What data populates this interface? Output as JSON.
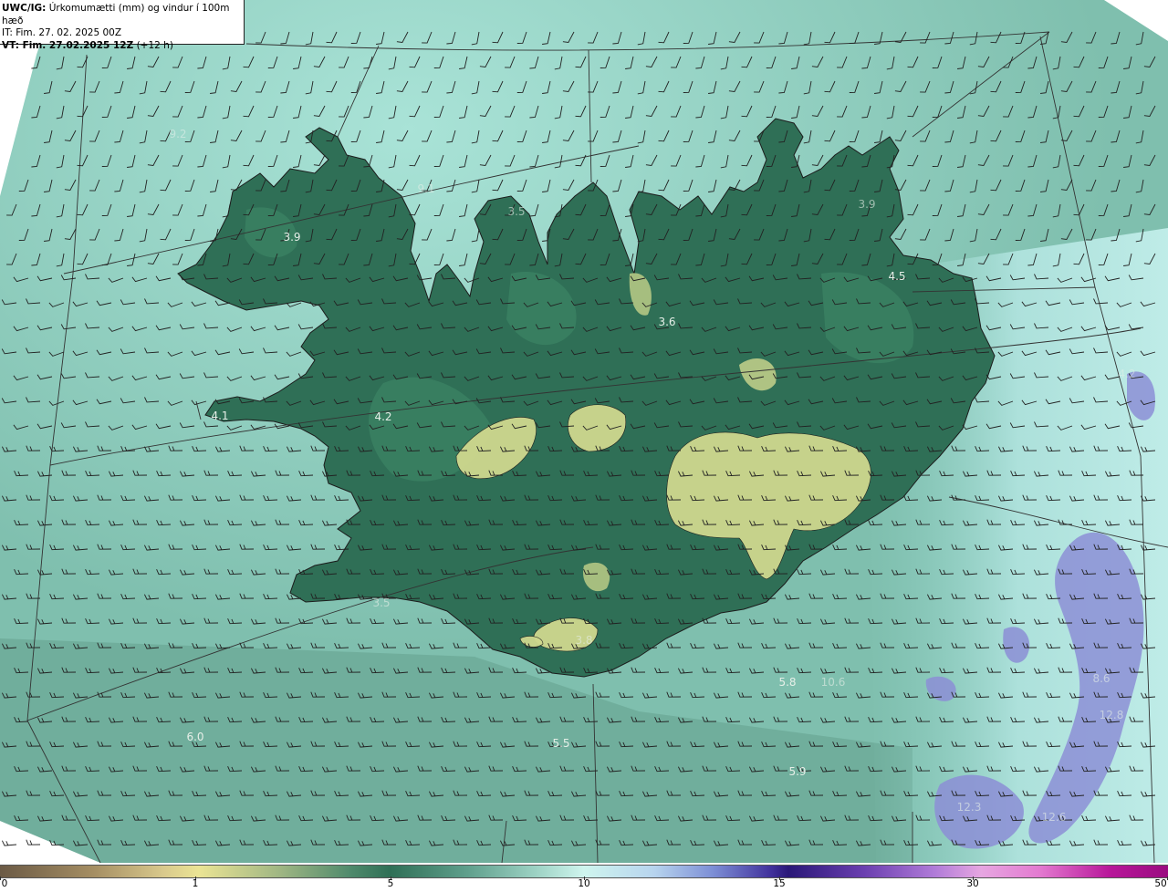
{
  "header": {
    "code": "UWC/IG:",
    "description": "Úrkomumætti (mm) og vindur í 100m hæð",
    "it_line": "IT: Fim. 27. 02. 2025 00Z",
    "vt_label": "VT: Fim. 27.02.2025 12Z",
    "vt_offset": "(+12 h)"
  },
  "value_labels": [
    {
      "text": "9.2",
      "dim": true
    },
    {
      "text": "3.9",
      "dim": false
    },
    {
      "text": "9.1",
      "dim": true
    },
    {
      "text": "3.5",
      "dim": true
    },
    {
      "text": "3.6",
      "dim": false
    },
    {
      "text": "4.5",
      "dim": false
    },
    {
      "text": "3.9",
      "dim": true
    },
    {
      "text": "4.1",
      "dim": false
    },
    {
      "text": "4.2",
      "dim": false
    },
    {
      "text": "3.5",
      "dim": true
    },
    {
      "text": "3.8",
      "dim": true
    },
    {
      "text": "5.8",
      "dim": false
    },
    {
      "text": "10.6",
      "dim": true
    },
    {
      "text": "6.0",
      "dim": false
    },
    {
      "text": "5.5",
      "dim": false
    },
    {
      "text": "5.9",
      "dim": false
    },
    {
      "text": "8.6",
      "dim": true
    },
    {
      "text": "12.8",
      "dim": true
    },
    {
      "text": "12.3",
      "dim": true
    },
    {
      "text": "12.6",
      "dim": true
    },
    {
      "text": "4.2",
      "dim": true
    }
  ],
  "colorbar": {
    "labels": [
      "0",
      "1",
      "5",
      "10",
      "15",
      "30",
      "50"
    ],
    "ticks_fraction": [
      0,
      0.167,
      0.334,
      0.5,
      0.667,
      0.833,
      1.0
    ]
  },
  "colors": {
    "sea": "#7fc2b2",
    "land": "#2f6f56",
    "glacier": "#cfd88e",
    "heavy_precip": "#8d8fd8",
    "coastline": "#1c1c1c",
    "wind_barb": "#222222"
  }
}
